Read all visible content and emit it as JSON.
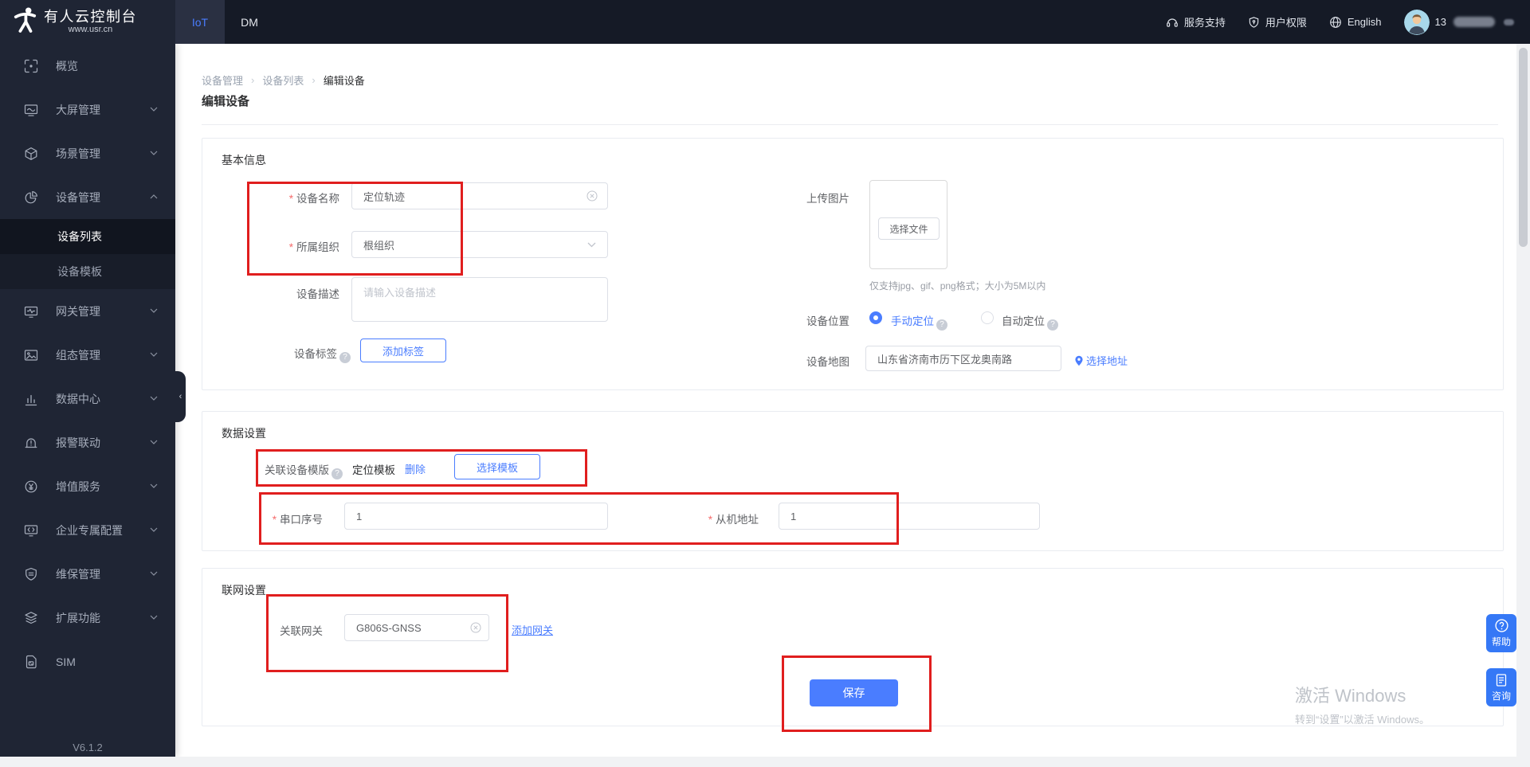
{
  "header": {
    "logo_title": "有人云控制台",
    "logo_subtitle": "www.usr.cn",
    "tabs": [
      {
        "label": "IoT",
        "active": true
      },
      {
        "label": "DM",
        "active": false
      }
    ],
    "links": {
      "support": "服务支持",
      "permissions": "用户权限",
      "language": "English"
    },
    "user_phone_prefix": "13"
  },
  "sidebar": {
    "items": [
      {
        "label": "概览",
        "icon": "overview-icon"
      },
      {
        "label": "大屏管理",
        "icon": "big-screen-icon",
        "expandable": true
      },
      {
        "label": "场景管理",
        "icon": "scene-cube-icon",
        "expandable": true
      },
      {
        "label": "设备管理",
        "icon": "device-pie-icon",
        "expandable": true,
        "expanded": true
      },
      {
        "label": "网关管理",
        "icon": "gateway-monitor-icon",
        "expandable": true
      },
      {
        "label": "组态管理",
        "icon": "configuration-image-icon",
        "expandable": true
      },
      {
        "label": "数据中心",
        "icon": "data-bars-icon",
        "expandable": true
      },
      {
        "label": "报警联动",
        "icon": "alarm-icon",
        "expandable": true
      },
      {
        "label": "增值服务",
        "icon": "yuan-circle-icon",
        "expandable": true
      },
      {
        "label": "企业专属配置",
        "icon": "enterprise-code-icon",
        "expandable": true
      },
      {
        "label": "维保管理",
        "icon": "maintenance-shield-icon",
        "expandable": true
      },
      {
        "label": "扩展功能",
        "icon": "layers-icon",
        "expandable": true
      },
      {
        "label": "SIM",
        "icon": "sim-card-icon"
      }
    ],
    "submenu": [
      {
        "label": "设备列表",
        "active": true
      },
      {
        "label": "设备模板",
        "active": false
      }
    ],
    "version": "V6.1.2"
  },
  "breadcrumb": {
    "items": [
      "设备管理",
      "设备列表",
      "编辑设备"
    ],
    "separator": "›"
  },
  "page": {
    "title": "编辑设备"
  },
  "basic": {
    "section_title": "基本信息",
    "device_name": {
      "label": "设备名称",
      "value": "定位轨迹"
    },
    "organization": {
      "label": "所属组织",
      "value": "根组织"
    },
    "description": {
      "label": "设备描述",
      "placeholder": "请输入设备描述"
    },
    "tags": {
      "label": "设备标签",
      "button": "添加标签"
    },
    "upload": {
      "label": "上传图片",
      "button": "选择文件",
      "note": "仅支持jpg、gif、png格式；大小为5M以内"
    },
    "location": {
      "label": "设备位置",
      "manual": "手动定位",
      "auto": "自动定位"
    },
    "map": {
      "label": "设备地图",
      "value": "山东省济南市历下区龙奥南路",
      "link": "选择地址"
    }
  },
  "data_settings": {
    "section_title": "数据设置",
    "template": {
      "label": "关联设备模版",
      "value": "定位模板",
      "delete": "删除",
      "select": "选择模板"
    },
    "serial": {
      "label": "串口序号",
      "value": "1"
    },
    "slave": {
      "label": "从机地址",
      "value": "1"
    }
  },
  "network": {
    "section_title": "联网设置",
    "gateway": {
      "label": "关联网关",
      "value": "G806S-GNSS",
      "link": "添加网关"
    },
    "save": "保存"
  },
  "watermark": {
    "line1": "激活 Windows",
    "line2": "转到“设置”以激活 Windows。"
  },
  "floating": {
    "help": "帮助",
    "consult": "咨询"
  },
  "colors": {
    "accent": "#4a7dff",
    "annotation": "#e01e1e",
    "sidebar_bg": "#1f2534",
    "header_bg": "#151a26"
  }
}
